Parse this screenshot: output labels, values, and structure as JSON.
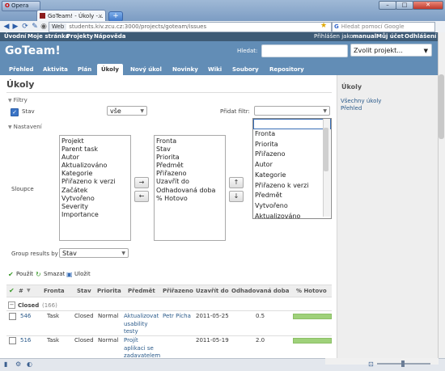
{
  "browser": {
    "menu_label": "Opera",
    "tab_title": "GoTeam! - Úkoly -...",
    "tab_close": "×",
    "new_tab": "+",
    "window_buttons": {
      "minimize": "–",
      "maximize": "□",
      "close": "✕"
    },
    "address_label": "Web",
    "url": "students.kiv.zcu.cz:3000/projects/goteam/issues",
    "search_placeholder": "Hledat pomocí Google",
    "search_engine": "G"
  },
  "topmenu": {
    "items": [
      "Úvodní",
      "Moje stránka",
      "Projekty",
      "Nápověda"
    ],
    "logged_in_prefix": "Přihlášen jako",
    "username": "manual",
    "account": "Můj účet",
    "logout": "Odhlášení"
  },
  "header": {
    "logo": "GoTeam!",
    "search_label": "Hledat:",
    "search_value": "",
    "project_jump": "Zvolit projekt..."
  },
  "tabs": [
    "Přehled",
    "Aktivita",
    "Plán",
    "Úkoly",
    "Nový úkol",
    "Novinky",
    "Wiki",
    "Soubory",
    "Repository"
  ],
  "selected_tab": "Úkoly",
  "page": {
    "title": "Úkoly",
    "filters_legend": "Filtry",
    "filter_status_label": "Stav",
    "filter_status_value": "vše",
    "add_filter_label": "Přidat filtr:",
    "add_filter_value": "",
    "options_legend": "Nastavení",
    "columns_label": "Sloupce",
    "available_columns": [
      "Projekt",
      "Parent task",
      "Autor",
      "Aktualizováno",
      "Kategorie",
      "Přiřazeno k verzi",
      "Začátek",
      "Vytvořeno",
      "Severity",
      "Importance"
    ],
    "selected_columns": [
      "Fronta",
      "Stav",
      "Priorita",
      "Předmět",
      "Přiřazeno",
      "Uzavřít do",
      "Odhadovaná doba",
      "% Hotovo"
    ],
    "move_right": "→",
    "move_left": "←",
    "move_up": "↑",
    "move_down": "↓",
    "group_label": "Group results by",
    "group_value": "Stav",
    "actions": {
      "apply": "Použít",
      "clear": "Smazat",
      "save": "Uložit"
    }
  },
  "filter_dropdown": {
    "options": [
      "",
      "Fronta",
      "Priorita",
      "Přiřazeno",
      "Autor",
      "Kategorie",
      "Přiřazeno k verzi",
      "Předmět",
      "Vytvořeno",
      "Aktualizováno"
    ],
    "highlighted_index": 0
  },
  "table": {
    "check_all": "✔",
    "columns": [
      "#",
      "Fronta",
      "Stav",
      "Priorita",
      "Předmět",
      "Přiřazeno",
      "Uzavřít do",
      "Odhadovaná doba",
      "% Hotovo"
    ],
    "sort_indicator": "▼",
    "group": {
      "name": "Closed",
      "count": "(166)",
      "toggle": "−"
    },
    "rows": [
      {
        "id": "546",
        "tracker": "Task",
        "status": "Closed",
        "priority": "Normal",
        "subject": "Aktualizovat usability testy",
        "assignee": "Petr Pícha",
        "due": "2011-05-25",
        "estimate": "0.5",
        "done": 100
      },
      {
        "id": "516",
        "tracker": "Task",
        "status": "Closed",
        "priority": "Normal",
        "subject": "Projít aplikaci se zadavatelem",
        "assignee": "",
        "due": "2011-05-19",
        "estimate": "2.0",
        "done": 100
      }
    ]
  },
  "sidebar": {
    "title": "Úkoly",
    "links": [
      "Všechny úkoly",
      "Přehled"
    ]
  },
  "colors": {
    "header": "#628db6",
    "topmenu": "#3e5b76",
    "link": "#2a5a8a",
    "progress": "#9fd17a"
  }
}
